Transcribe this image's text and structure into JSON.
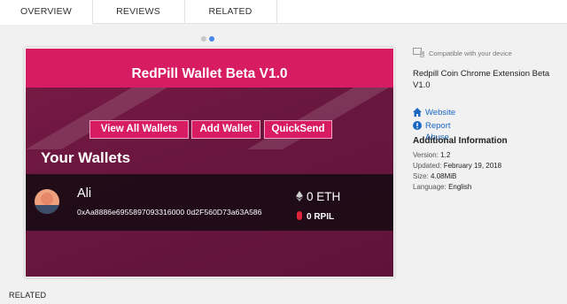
{
  "tabs": [
    {
      "label": "OVERVIEW",
      "active": true
    },
    {
      "label": "REVIEWS",
      "active": false
    },
    {
      "label": "RELATED",
      "active": false
    }
  ],
  "carousel": {
    "count": 2,
    "active_index": 1
  },
  "app": {
    "title": "RedPill Wallet Beta V1.0",
    "buttons": [
      "View All Wallets",
      "Add Wallet",
      "QuickSend"
    ],
    "section_title": "Your Wallets",
    "wallet": {
      "name": "Ali",
      "address": "0xAa8886e6955897093316000 0d2F560D73a63A586",
      "eth_balance": "0 ETH",
      "rpil_balance": "0 RPIL"
    }
  },
  "sidebar": {
    "compatibility": "Compatible with your device",
    "extension_title": "Redpill Coin Chrome Extension Beta V1.0",
    "links": [
      {
        "label": "Website",
        "icon": "home-icon"
      },
      {
        "label": "Report Abuse",
        "icon": "report-icon"
      }
    ],
    "info_heading": "Additional Information",
    "info": [
      {
        "key": "Version:",
        "value": "1.2"
      },
      {
        "key": "Updated:",
        "value": "February 19, 2018"
      },
      {
        "key": "Size:",
        "value": "4.08MiB"
      },
      {
        "key": "Language:",
        "value": "English"
      }
    ]
  },
  "footer": {
    "related_label": "RELATED"
  },
  "colors": {
    "accent": "#d71c63",
    "panel": "#6b1740",
    "link": "#1a66c5",
    "dot_active": "#4a86e8"
  }
}
